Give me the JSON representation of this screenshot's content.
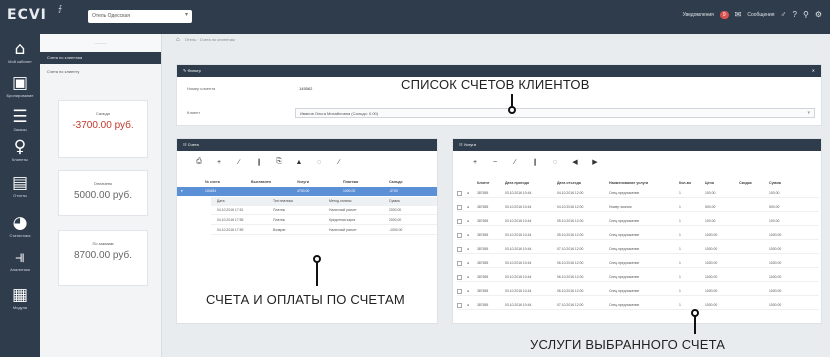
{
  "topbar": {
    "logo": "ЕСVI",
    "select_value": "Отель Одесская",
    "notifications_label": "Уведомления",
    "notifications_badge": "9",
    "messages_label": "Сообщения"
  },
  "rail": [
    {
      "icon": "home-icon",
      "glyph": "⌂",
      "label": "Мой кабинет"
    },
    {
      "icon": "store-icon",
      "glyph": "▣",
      "label": "Бронирование"
    },
    {
      "icon": "document-icon",
      "glyph": "☰",
      "label": "Заказы"
    },
    {
      "icon": "user-icon",
      "glyph": "♀",
      "label": "Клиенты"
    },
    {
      "icon": "monitor-icon",
      "glyph": "▤",
      "label": "Отчеты"
    },
    {
      "icon": "pie-chart-icon",
      "glyph": "◕",
      "label": "Статистика"
    },
    {
      "icon": "bar-chart-icon",
      "glyph": "⫣",
      "label": "Аналитика"
    },
    {
      "icon": "screen-icon",
      "glyph": "▦",
      "label": "Модули"
    }
  ],
  "col2": {
    "head": "———",
    "selected": "Счета по клиентам",
    "line": "Счета по клиенту",
    "cards": [
      {
        "label": "Сальдо",
        "value": "-3700.00 руб.",
        "negative": true
      },
      {
        "label": "Оплачено",
        "value": "5000.00 руб.",
        "negative": false
      },
      {
        "label": "По заказам",
        "value": "8700.00 руб.",
        "negative": false
      }
    ]
  },
  "breadcrumb": "Отель · Счета по клиентам",
  "filter": {
    "title": "Фильтр",
    "client_number_label": "Номер клиента",
    "client_number_value": "145562",
    "client_label": "Клиент",
    "client_value": "Иванов Ольга Михайловна (Сальдо: 0.00)"
  },
  "callouts": {
    "top": "СПИСОК СЧЕТОВ КЛИЕНТОВ",
    "left": "СЧЕТА И ОПЛАТЫ ПО СЧЕТАМ",
    "right": "УСЛУГИ ВЫБРАННОГО СЧЕТА"
  },
  "accounts": {
    "title": "Счета",
    "toolbar": [
      "⎙",
      "+",
      "∕",
      "❙",
      "⎘",
      "▲",
      "◌",
      "∕"
    ],
    "headers": [
      "№ счета",
      "Выставлен",
      "Услуги",
      "Платежи",
      "Сальдо"
    ],
    "selected_row": [
      "100451",
      "",
      "4700.00",
      "1000.00",
      "-3700"
    ],
    "sub_headers": [
      "Дата",
      "Тип платежа",
      "Метод оплаты",
      "Сумма"
    ],
    "payments": [
      [
        "04.10.2016 17:51",
        "Платеж",
        "Наличный расчет",
        "2000.00"
      ],
      [
        "04.10.2016 17:55",
        "Платеж",
        "Кредитная карта",
        "2000.00"
      ],
      [
        "04.10.2016 17:59",
        "Возврат",
        "Наличный расчет",
        "-1000.00"
      ]
    ]
  },
  "services": {
    "title": "Услуги",
    "toolbar": [
      "+",
      "−",
      "∕",
      "❙",
      "◌",
      "◀",
      "▶"
    ],
    "headers": [
      "",
      "",
      "Клиент",
      "Дата приезда",
      "Дата отъезда",
      "Наименование услуги",
      "Кол-во",
      "Цена",
      "Скидка",
      "Сумма"
    ],
    "rows": [
      [
        "",
        "●",
        "387655",
        "03.10.2016 10:44",
        "04.10.2016 12:00",
        "Спец.предложение",
        "1",
        "100.00",
        "",
        "100.00"
      ],
      [
        "",
        "●",
        "387655",
        "03.10.2016 10:44",
        "04.10.2016 12:00",
        "Номер эконом",
        "1",
        "500.00",
        "",
        "500.00"
      ],
      [
        "",
        "●",
        "387655",
        "03.10.2016 10:44",
        "05.10.2016 12:00",
        "Спец.предложение",
        "1",
        "100.00",
        "",
        "100.00"
      ],
      [
        "",
        "●",
        "387655",
        "03.10.2016 10:44",
        "05.10.2016 12:00",
        "Спец.предложение",
        "1",
        "1000.00",
        "",
        "1000.00"
      ],
      [
        "",
        "●",
        "387655",
        "03.10.2016 10:44",
        "07.10.2016 12:00",
        "Спец.предложение",
        "1",
        "1000.00",
        "",
        "1000.00"
      ],
      [
        "",
        "●",
        "387655",
        "03.10.2016 10:44",
        "06.10.2016 12:00",
        "Спец.предложение",
        "1",
        "1000.00",
        "",
        "1000.00"
      ],
      [
        "",
        "●",
        "387655",
        "03.10.2016 10:44",
        "06.10.2016 12:00",
        "Спец.предложение",
        "1",
        "1000.00",
        "",
        "1000.00"
      ],
      [
        "",
        "●",
        "387655",
        "03.10.2016 10:44",
        "06.10.2016 12:00",
        "Спец.предложение",
        "1",
        "1000.00",
        "",
        "1000.00"
      ],
      [
        "",
        "●",
        "387655",
        "03.10.2016 10:44",
        "07.10.2016 12:00",
        "Спец.предложение",
        "1",
        "1000.00",
        "",
        "1000.00"
      ]
    ]
  },
  "colors": {
    "nav_dark": "#2f3c4b",
    "selected_row": "#5b8fd6",
    "negative": "#c0392b"
  }
}
